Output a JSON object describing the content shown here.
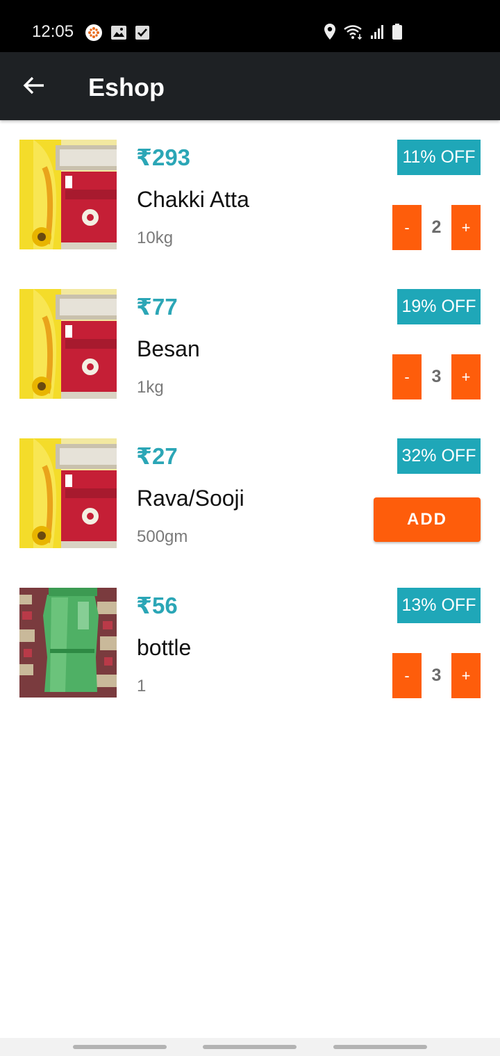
{
  "status_bar": {
    "time": "12:05",
    "left_icons": [
      "app-notification-icon",
      "image-icon",
      "checkbox-icon"
    ],
    "right_icons": [
      "location-icon",
      "wifi-icon",
      "signal-icon",
      "battery-icon"
    ]
  },
  "app_bar": {
    "title": "Eshop",
    "back_icon": "arrow-back-icon"
  },
  "colors": {
    "price": "#2ba6b6",
    "badge": "#1fa7b8",
    "accent": "#fe5d0b",
    "app_bar": "#1e2124"
  },
  "products": [
    {
      "price": "₹293",
      "name": "Chakki Atta",
      "unit": "10kg",
      "discount": "11% OFF",
      "minus": "-",
      "plus": "+",
      "quantity": "2"
    },
    {
      "price": "₹77",
      "name": "Besan",
      "unit": "1kg",
      "discount": "19% OFF",
      "minus": "-",
      "plus": "+",
      "quantity": "3"
    },
    {
      "price": "₹27",
      "name": "Rava/Sooji",
      "unit": "500gm",
      "discount": "32% OFF",
      "add_label": "ADD"
    },
    {
      "price": "₹56",
      "name": "bottle",
      "unit": "1",
      "discount": "13% OFF",
      "minus": "-",
      "plus": "+",
      "quantity": "3"
    }
  ]
}
